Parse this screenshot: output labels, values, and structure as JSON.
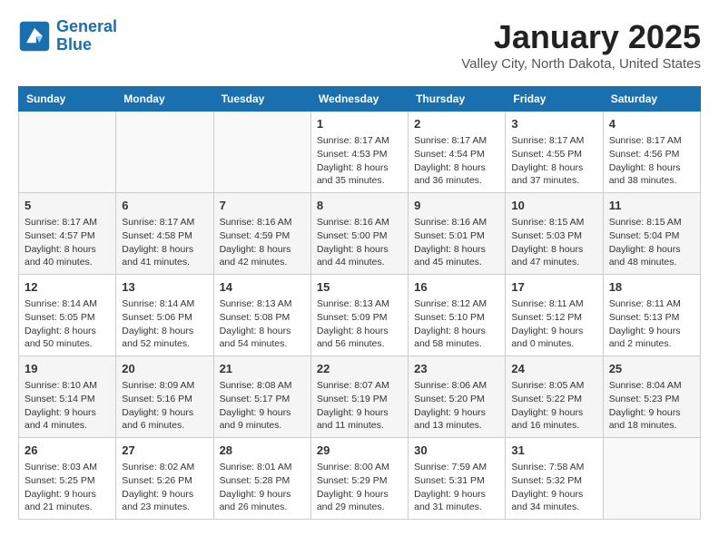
{
  "logo": {
    "line1": "General",
    "line2": "Blue"
  },
  "title": "January 2025",
  "location": "Valley City, North Dakota, United States",
  "weekdays": [
    "Sunday",
    "Monday",
    "Tuesday",
    "Wednesday",
    "Thursday",
    "Friday",
    "Saturday"
  ],
  "weeks": [
    [
      {
        "day": "",
        "sunrise": "",
        "sunset": "",
        "daylight": ""
      },
      {
        "day": "",
        "sunrise": "",
        "sunset": "",
        "daylight": ""
      },
      {
        "day": "",
        "sunrise": "",
        "sunset": "",
        "daylight": ""
      },
      {
        "day": "1",
        "sunrise": "Sunrise: 8:17 AM",
        "sunset": "Sunset: 4:53 PM",
        "daylight": "Daylight: 8 hours and 35 minutes."
      },
      {
        "day": "2",
        "sunrise": "Sunrise: 8:17 AM",
        "sunset": "Sunset: 4:54 PM",
        "daylight": "Daylight: 8 hours and 36 minutes."
      },
      {
        "day": "3",
        "sunrise": "Sunrise: 8:17 AM",
        "sunset": "Sunset: 4:55 PM",
        "daylight": "Daylight: 8 hours and 37 minutes."
      },
      {
        "day": "4",
        "sunrise": "Sunrise: 8:17 AM",
        "sunset": "Sunset: 4:56 PM",
        "daylight": "Daylight: 8 hours and 38 minutes."
      }
    ],
    [
      {
        "day": "5",
        "sunrise": "Sunrise: 8:17 AM",
        "sunset": "Sunset: 4:57 PM",
        "daylight": "Daylight: 8 hours and 40 minutes."
      },
      {
        "day": "6",
        "sunrise": "Sunrise: 8:17 AM",
        "sunset": "Sunset: 4:58 PM",
        "daylight": "Daylight: 8 hours and 41 minutes."
      },
      {
        "day": "7",
        "sunrise": "Sunrise: 8:16 AM",
        "sunset": "Sunset: 4:59 PM",
        "daylight": "Daylight: 8 hours and 42 minutes."
      },
      {
        "day": "8",
        "sunrise": "Sunrise: 8:16 AM",
        "sunset": "Sunset: 5:00 PM",
        "daylight": "Daylight: 8 hours and 44 minutes."
      },
      {
        "day": "9",
        "sunrise": "Sunrise: 8:16 AM",
        "sunset": "Sunset: 5:01 PM",
        "daylight": "Daylight: 8 hours and 45 minutes."
      },
      {
        "day": "10",
        "sunrise": "Sunrise: 8:15 AM",
        "sunset": "Sunset: 5:03 PM",
        "daylight": "Daylight: 8 hours and 47 minutes."
      },
      {
        "day": "11",
        "sunrise": "Sunrise: 8:15 AM",
        "sunset": "Sunset: 5:04 PM",
        "daylight": "Daylight: 8 hours and 48 minutes."
      }
    ],
    [
      {
        "day": "12",
        "sunrise": "Sunrise: 8:14 AM",
        "sunset": "Sunset: 5:05 PM",
        "daylight": "Daylight: 8 hours and 50 minutes."
      },
      {
        "day": "13",
        "sunrise": "Sunrise: 8:14 AM",
        "sunset": "Sunset: 5:06 PM",
        "daylight": "Daylight: 8 hours and 52 minutes."
      },
      {
        "day": "14",
        "sunrise": "Sunrise: 8:13 AM",
        "sunset": "Sunset: 5:08 PM",
        "daylight": "Daylight: 8 hours and 54 minutes."
      },
      {
        "day": "15",
        "sunrise": "Sunrise: 8:13 AM",
        "sunset": "Sunset: 5:09 PM",
        "daylight": "Daylight: 8 hours and 56 minutes."
      },
      {
        "day": "16",
        "sunrise": "Sunrise: 8:12 AM",
        "sunset": "Sunset: 5:10 PM",
        "daylight": "Daylight: 8 hours and 58 minutes."
      },
      {
        "day": "17",
        "sunrise": "Sunrise: 8:11 AM",
        "sunset": "Sunset: 5:12 PM",
        "daylight": "Daylight: 9 hours and 0 minutes."
      },
      {
        "day": "18",
        "sunrise": "Sunrise: 8:11 AM",
        "sunset": "Sunset: 5:13 PM",
        "daylight": "Daylight: 9 hours and 2 minutes."
      }
    ],
    [
      {
        "day": "19",
        "sunrise": "Sunrise: 8:10 AM",
        "sunset": "Sunset: 5:14 PM",
        "daylight": "Daylight: 9 hours and 4 minutes."
      },
      {
        "day": "20",
        "sunrise": "Sunrise: 8:09 AM",
        "sunset": "Sunset: 5:16 PM",
        "daylight": "Daylight: 9 hours and 6 minutes."
      },
      {
        "day": "21",
        "sunrise": "Sunrise: 8:08 AM",
        "sunset": "Sunset: 5:17 PM",
        "daylight": "Daylight: 9 hours and 9 minutes."
      },
      {
        "day": "22",
        "sunrise": "Sunrise: 8:07 AM",
        "sunset": "Sunset: 5:19 PM",
        "daylight": "Daylight: 9 hours and 11 minutes."
      },
      {
        "day": "23",
        "sunrise": "Sunrise: 8:06 AM",
        "sunset": "Sunset: 5:20 PM",
        "daylight": "Daylight: 9 hours and 13 minutes."
      },
      {
        "day": "24",
        "sunrise": "Sunrise: 8:05 AM",
        "sunset": "Sunset: 5:22 PM",
        "daylight": "Daylight: 9 hours and 16 minutes."
      },
      {
        "day": "25",
        "sunrise": "Sunrise: 8:04 AM",
        "sunset": "Sunset: 5:23 PM",
        "daylight": "Daylight: 9 hours and 18 minutes."
      }
    ],
    [
      {
        "day": "26",
        "sunrise": "Sunrise: 8:03 AM",
        "sunset": "Sunset: 5:25 PM",
        "daylight": "Daylight: 9 hours and 21 minutes."
      },
      {
        "day": "27",
        "sunrise": "Sunrise: 8:02 AM",
        "sunset": "Sunset: 5:26 PM",
        "daylight": "Daylight: 9 hours and 23 minutes."
      },
      {
        "day": "28",
        "sunrise": "Sunrise: 8:01 AM",
        "sunset": "Sunset: 5:28 PM",
        "daylight": "Daylight: 9 hours and 26 minutes."
      },
      {
        "day": "29",
        "sunrise": "Sunrise: 8:00 AM",
        "sunset": "Sunset: 5:29 PM",
        "daylight": "Daylight: 9 hours and 29 minutes."
      },
      {
        "day": "30",
        "sunrise": "Sunrise: 7:59 AM",
        "sunset": "Sunset: 5:31 PM",
        "daylight": "Daylight: 9 hours and 31 minutes."
      },
      {
        "day": "31",
        "sunrise": "Sunrise: 7:58 AM",
        "sunset": "Sunset: 5:32 PM",
        "daylight": "Daylight: 9 hours and 34 minutes."
      },
      {
        "day": "",
        "sunrise": "",
        "sunset": "",
        "daylight": ""
      }
    ]
  ]
}
